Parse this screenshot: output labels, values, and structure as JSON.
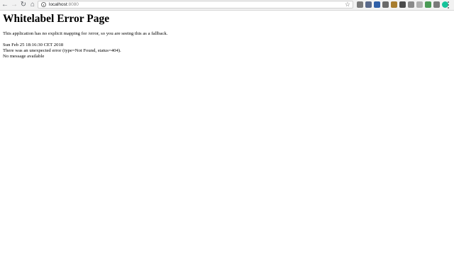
{
  "browser": {
    "url_host": "localhost",
    "url_port": ":8080",
    "nav_icons": [
      "back-arrow-icon",
      "forward-arrow-icon",
      "reload-icon",
      "home-icon"
    ],
    "extensions": [
      {
        "name": "ext-1-icon",
        "color": "#7a7a7a"
      },
      {
        "name": "ext-2-icon",
        "color": "#5a6a8a"
      },
      {
        "name": "ext-3-icon",
        "color": "#2f5fa8"
      },
      {
        "name": "ext-4-icon",
        "color": "#6a6a6a"
      },
      {
        "name": "ext-5-icon",
        "color": "#a87d2f"
      },
      {
        "name": "ext-6-icon",
        "color": "#4a4a4a"
      },
      {
        "name": "ext-7-icon",
        "color": "#8a8a8a"
      },
      {
        "name": "ext-8-icon",
        "color": "#b0b0b0"
      },
      {
        "name": "ext-9-icon",
        "color": "#4a9a55"
      },
      {
        "name": "ext-10-icon",
        "color": "#7a7a7a"
      },
      {
        "name": "grammarly-icon",
        "color": "#15c39a"
      }
    ]
  },
  "page": {
    "title": "Whitelabel Error Page",
    "fallback_text": "This application has no explicit mapping for /error, so you are seeing this as a fallback.",
    "timestamp": "Sun Feb 25 18:16:30 CET 2018",
    "error_text": "There was an unexpected error (type=Not Found, status=404).",
    "message_text": "No message available"
  }
}
